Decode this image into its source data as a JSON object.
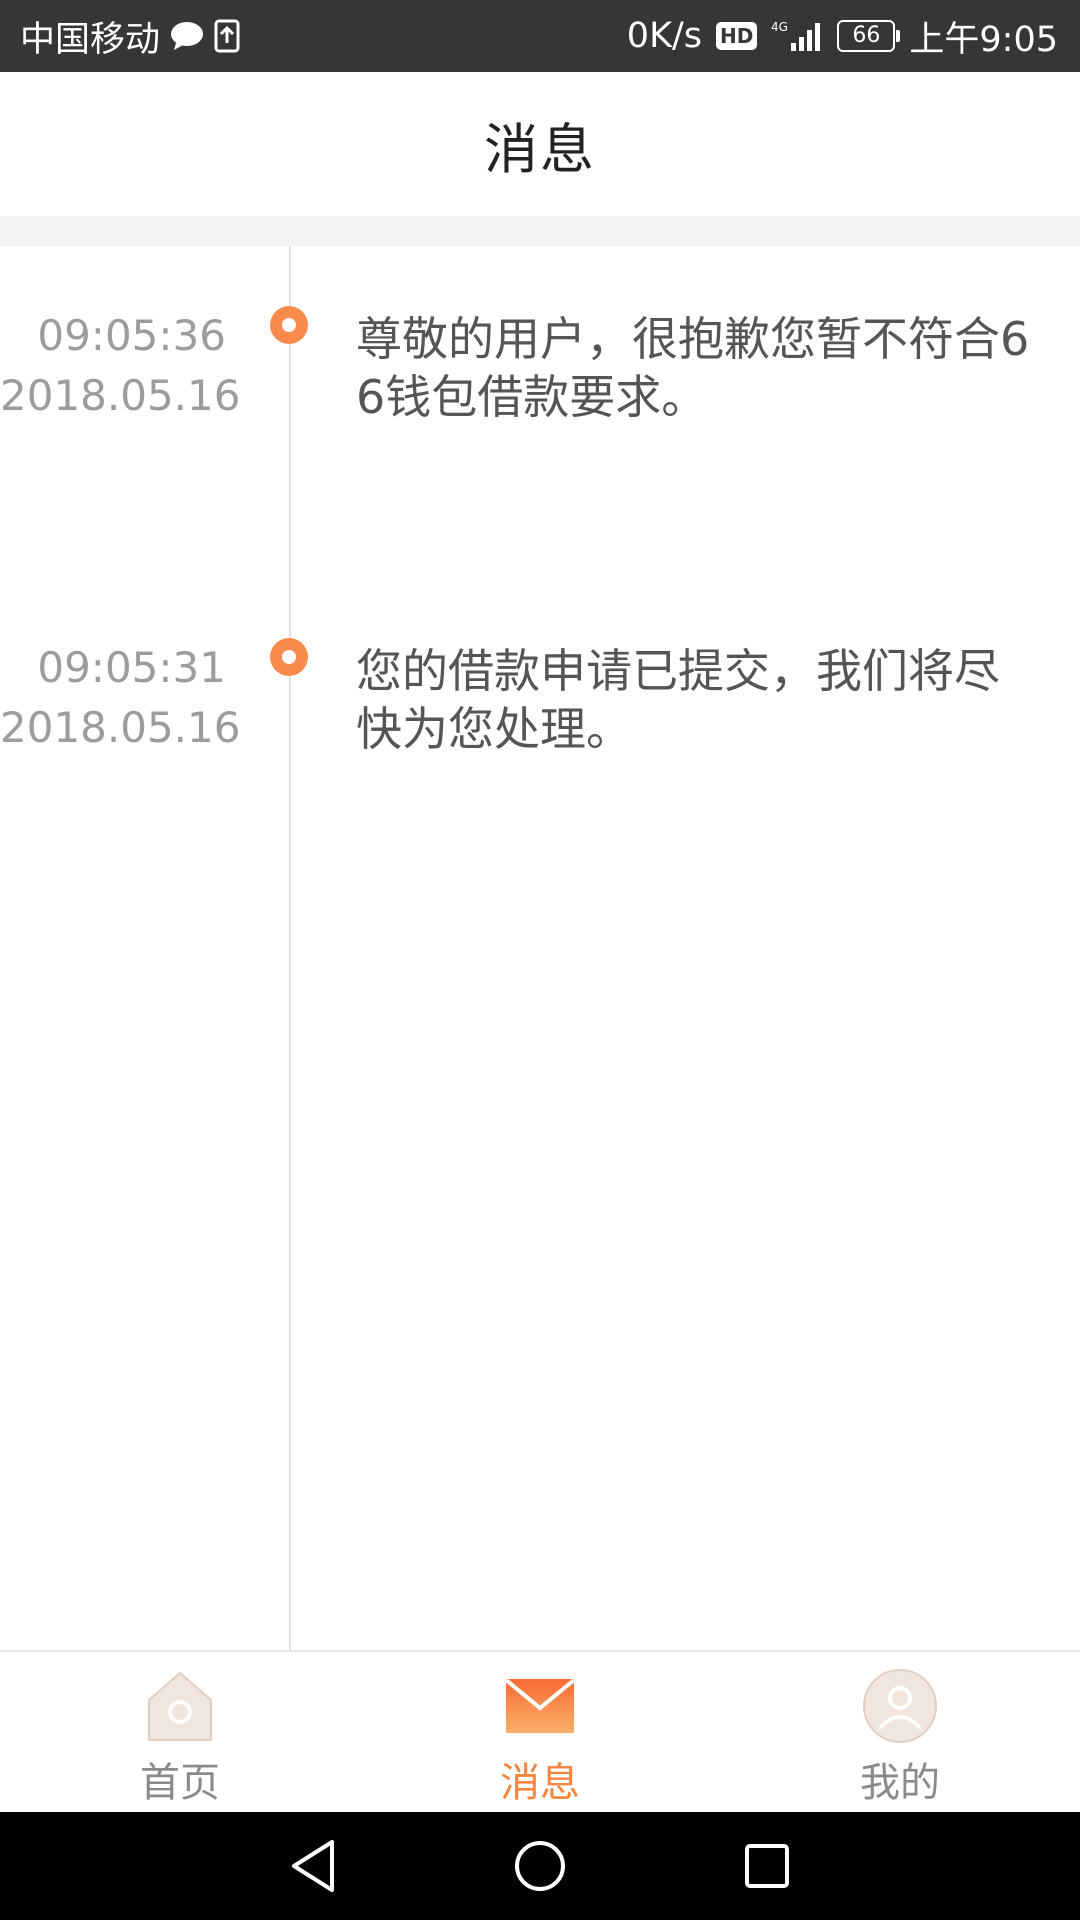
{
  "status_bar": {
    "carrier": "中国移动",
    "net_speed": "0K/s",
    "hd_label": "HD",
    "network_type": "4G",
    "battery_level": "66",
    "time": "上午9:05",
    "icons": [
      "chat-bubble-icon",
      "upload-icon",
      "signal-icon"
    ]
  },
  "header": {
    "title": "消息"
  },
  "messages": [
    {
      "time": "09:05:36",
      "date": "2018.05.16",
      "text": "尊敬的用户，很抱歉您暂不符合66钱包借款要求。"
    },
    {
      "time": "09:05:31",
      "date": "2018.05.16",
      "text": "您的借款申请已提交，我们将尽快为您处理。"
    }
  ],
  "tabbar": {
    "tabs": [
      {
        "label": "首页",
        "icon": "home-icon",
        "active": false
      },
      {
        "label": "消息",
        "icon": "mail-icon",
        "active": true
      },
      {
        "label": "我的",
        "icon": "profile-icon",
        "active": false
      }
    ]
  },
  "colors": {
    "accent": "#f5843e",
    "status_bar_bg": "#363636",
    "timeline_dot": "#f98a4c",
    "inactive_tab_icon": "#efe3da"
  }
}
